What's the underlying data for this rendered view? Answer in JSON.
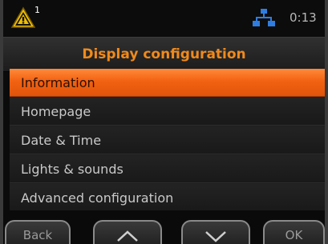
{
  "status": {
    "warning_count": "1",
    "time": "0:13",
    "warning_color": "#f0c000",
    "network_color": "#2f7de0"
  },
  "header": {
    "title": "Display configuration"
  },
  "menu": {
    "items": [
      {
        "label": "Information",
        "selected": true
      },
      {
        "label": "Homepage"
      },
      {
        "label": "Date & Time"
      },
      {
        "label": "Lights & sounds"
      },
      {
        "label": "Advanced configuration"
      }
    ]
  },
  "softkeys": {
    "back_label": "Back",
    "up_icon": "chevron-up-icon",
    "down_icon": "chevron-down-icon",
    "ok_label": "OK"
  },
  "accent": "#f26a1b"
}
